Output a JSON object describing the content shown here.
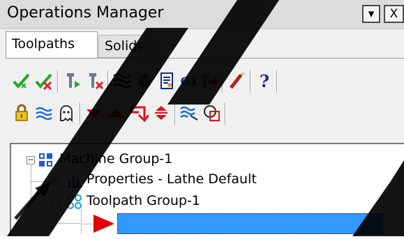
{
  "window": {
    "title": "Operations Manager",
    "dropdown_glyph": "▾",
    "close_glyph": "X"
  },
  "tabs": [
    {
      "label": "Toolpaths",
      "active": true
    },
    {
      "label": "Solids",
      "active": false
    }
  ],
  "toolbar1": {
    "icons": [
      "select-all-operations-icon",
      "select-all-dirty-operations-icon",
      "regenerate-icon",
      "regenerate-dirty-icon",
      "backplot-icon",
      "verify-icon",
      "simulate-icon",
      "post-g1-icon",
      "high-speed-icon",
      "lock-toolpath-icon",
      "help-icon"
    ],
    "g1_text": "G1",
    "help_glyph": "?"
  },
  "toolbar2": {
    "icons": [
      "lock-icon",
      "toggle-display-icon",
      "ghost-icon",
      "move-down-icon",
      "move-up-icon",
      "insert-arrow-icon",
      "expand-collapse-icon",
      "toolpath-display-icon",
      "delete-group-icon"
    ]
  },
  "tree": {
    "machine_group": "Machine Group-1",
    "properties": "Properties - Lathe Default",
    "toolpath_group": "Toolpath Group-1",
    "expand_glyph": "+",
    "collapse_glyph": "−"
  },
  "colors": {
    "selection": "#3399ff",
    "insert_arrow": "#e00000",
    "tree_blue": "#1e5bd6"
  }
}
